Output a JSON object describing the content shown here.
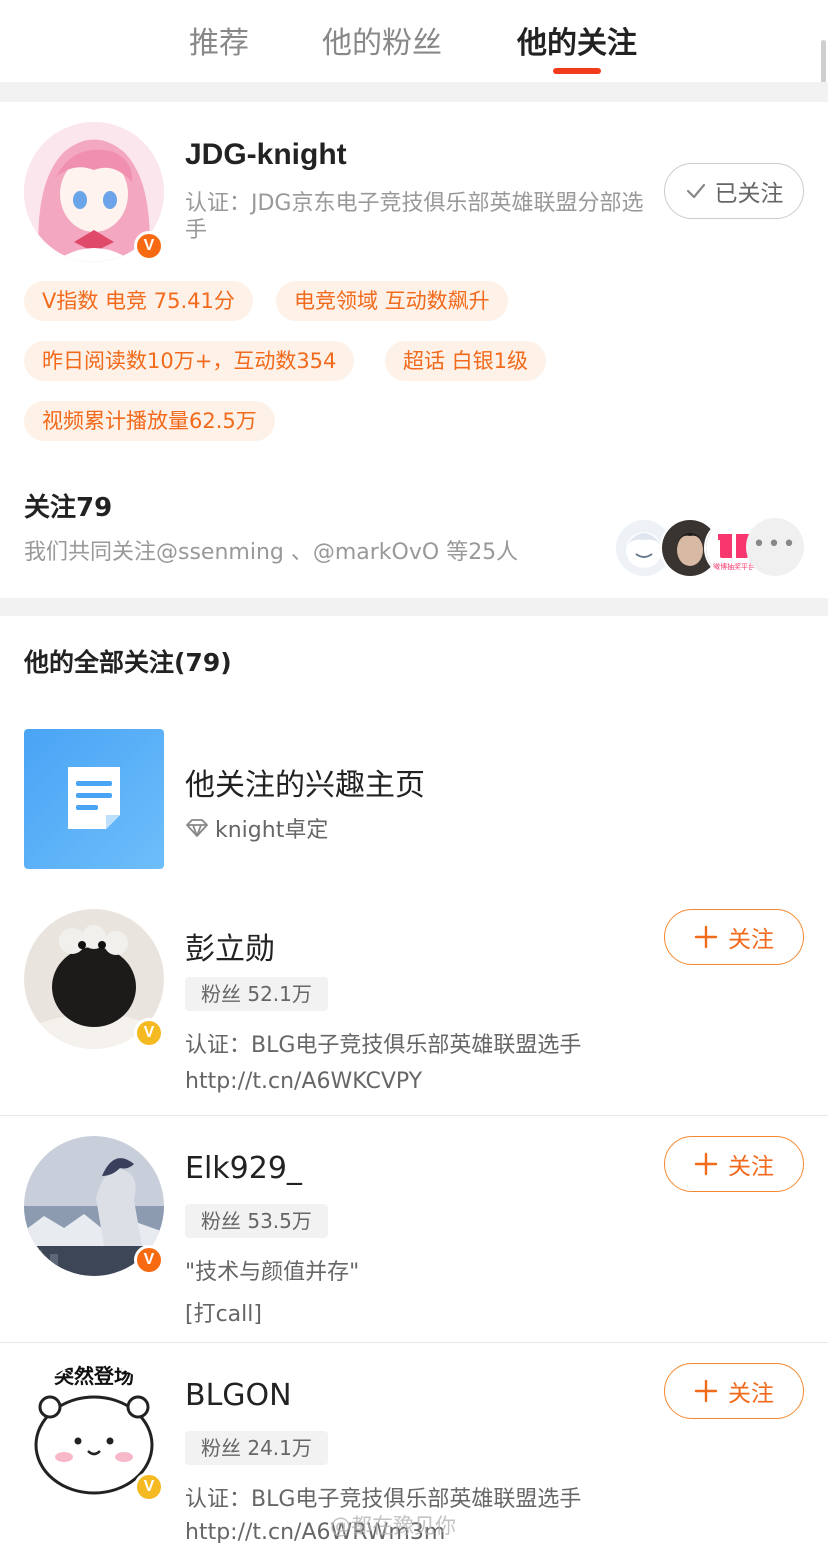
{
  "tabs": [
    {
      "label": "推荐"
    },
    {
      "label": "他的粉丝"
    },
    {
      "label": "他的关注"
    }
  ],
  "profile": {
    "name": "JDG-knight",
    "certification": "认证：JDG京东电子竞技俱乐部英雄联盟分部选手",
    "followed_button": "已关注",
    "badge": "V",
    "tags": [
      "V指数 电竞 75.41分",
      "电竞领域 互动数飙升",
      "昨日阅读数10万+，互动数354",
      "超话 白银1级",
      "视频累计播放量62.5万"
    ],
    "follow_count": "关注79",
    "mutual_text": "我们共同关注@ssenming 、@markOvO 等25人",
    "mini_avatar_3_label": "微博抽奖平台"
  },
  "section_title": "他的全部关注(79)",
  "interest": {
    "title": "他关注的兴趣主页",
    "subtitle": "knight卓定"
  },
  "follow_label": "关注",
  "users": [
    {
      "name": "彭立勋",
      "fans": "粉丝 52.1万",
      "line1": "认证：BLG电子竞技俱乐部英雄联盟选手",
      "line2": "http://t.cn/A6WKCVPY"
    },
    {
      "name": "Elk929_",
      "fans": "粉丝 53.5万",
      "line1": "\"技术与颜值并存\"",
      "line2": "[打call]"
    },
    {
      "name": "BLGON",
      "fans": "粉丝 24.1万",
      "line1": "认证：BLG电子竞技俱乐部英雄联盟选手",
      "line2": "http://t.cn/A6WRWm3m",
      "avatar_text": "突然登场"
    }
  ],
  "watermark": "@都在豫见你",
  "colors": {
    "accent": "#f23b1b",
    "orange": "#f26a1b",
    "tag_bg": "#fef1e8",
    "verified_orange": "#f76a12",
    "verified_yellow": "#f5b921"
  }
}
